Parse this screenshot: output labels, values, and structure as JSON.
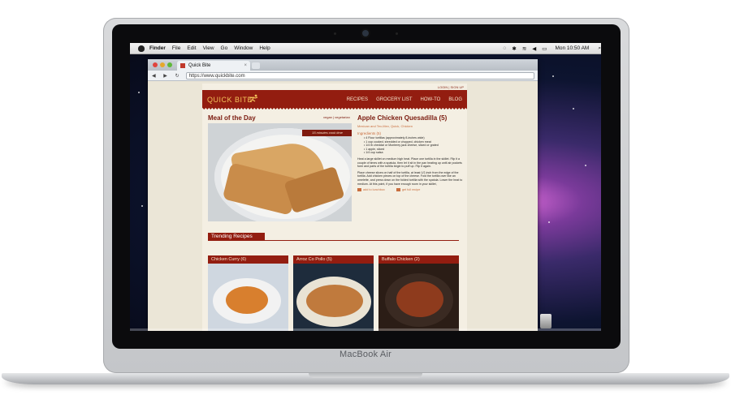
{
  "device": {
    "brand": "MacBook Air"
  },
  "menubar": {
    "app": "Finder",
    "items": [
      "File",
      "Edit",
      "View",
      "Go",
      "Window",
      "Help"
    ],
    "clock": "Mon 10:50 AM"
  },
  "browser": {
    "tab_title": "Quick Bite",
    "url": "https://www.quickbite.com",
    "nav_glyphs": "◀ ▶ ↻"
  },
  "site": {
    "login": "LOGIN | SIGN UP",
    "logo": "QUICK BITE",
    "nav": [
      "RECIPES",
      "GROCERY LIST",
      "HOW-TO",
      "BLOG"
    ],
    "meal_title": "Meal of the Day",
    "tags": "vegan | vegetarian",
    "ribbon": "15 minutes cook time",
    "recipe": {
      "title": "Apple Chicken Quesadilla (5)",
      "subtitle": "Mexican and Tex-Mex, Quick, Chicken",
      "ingredients_head": "Ingredients (5)",
      "ingredients": [
        "4 Flour tortillas (approximately 8-inches wide)",
        "1 cup cooked, shredded or chopped, chicken meat",
        "1/4 lb cheddar or Monterey jack cheese, sliced or grated",
        "1 apple, sliced",
        "1/4 cup salsa"
      ],
      "steps": [
        "Heat a large skillet on medium high heat. Place one tortilla in the skillet. Flip it a couple of times with a spatula, then let it sit in the pan heating up until air pockets form and parts of the tortilla begin to puff up. Flip it again.",
        "Place cheese slices on half of the tortilla, at least 1/2-inch from the edge of the tortilla. Add chicken pieces on top of the cheese. Fold the tortilla over like an omelette, and press down on the folded tortilla with the spatula. Lower the heat to medium. At this point, if you have enough room in your skillet,"
      ],
      "actions": [
        "add to lunchbox",
        "get full recipe"
      ]
    },
    "trending_label": "Trending Recipes",
    "trending": [
      {
        "name": "Chicken Curry (6)"
      },
      {
        "name": "Arroz Co Pollo (5)"
      },
      {
        "name": "Buffalo Chicken (2)"
      }
    ]
  },
  "colors": {
    "brand_red": "#931d10",
    "logo_gold": "#f3c15a",
    "accent_orange": "#c96e3f",
    "page_bg": "#ebe6d7"
  },
  "icons": [
    "apple-icon",
    "wifi-icon",
    "bluetooth-icon",
    "volume-icon",
    "battery-icon",
    "search-icon",
    "runner-logo-icon",
    "trash-icon"
  ]
}
